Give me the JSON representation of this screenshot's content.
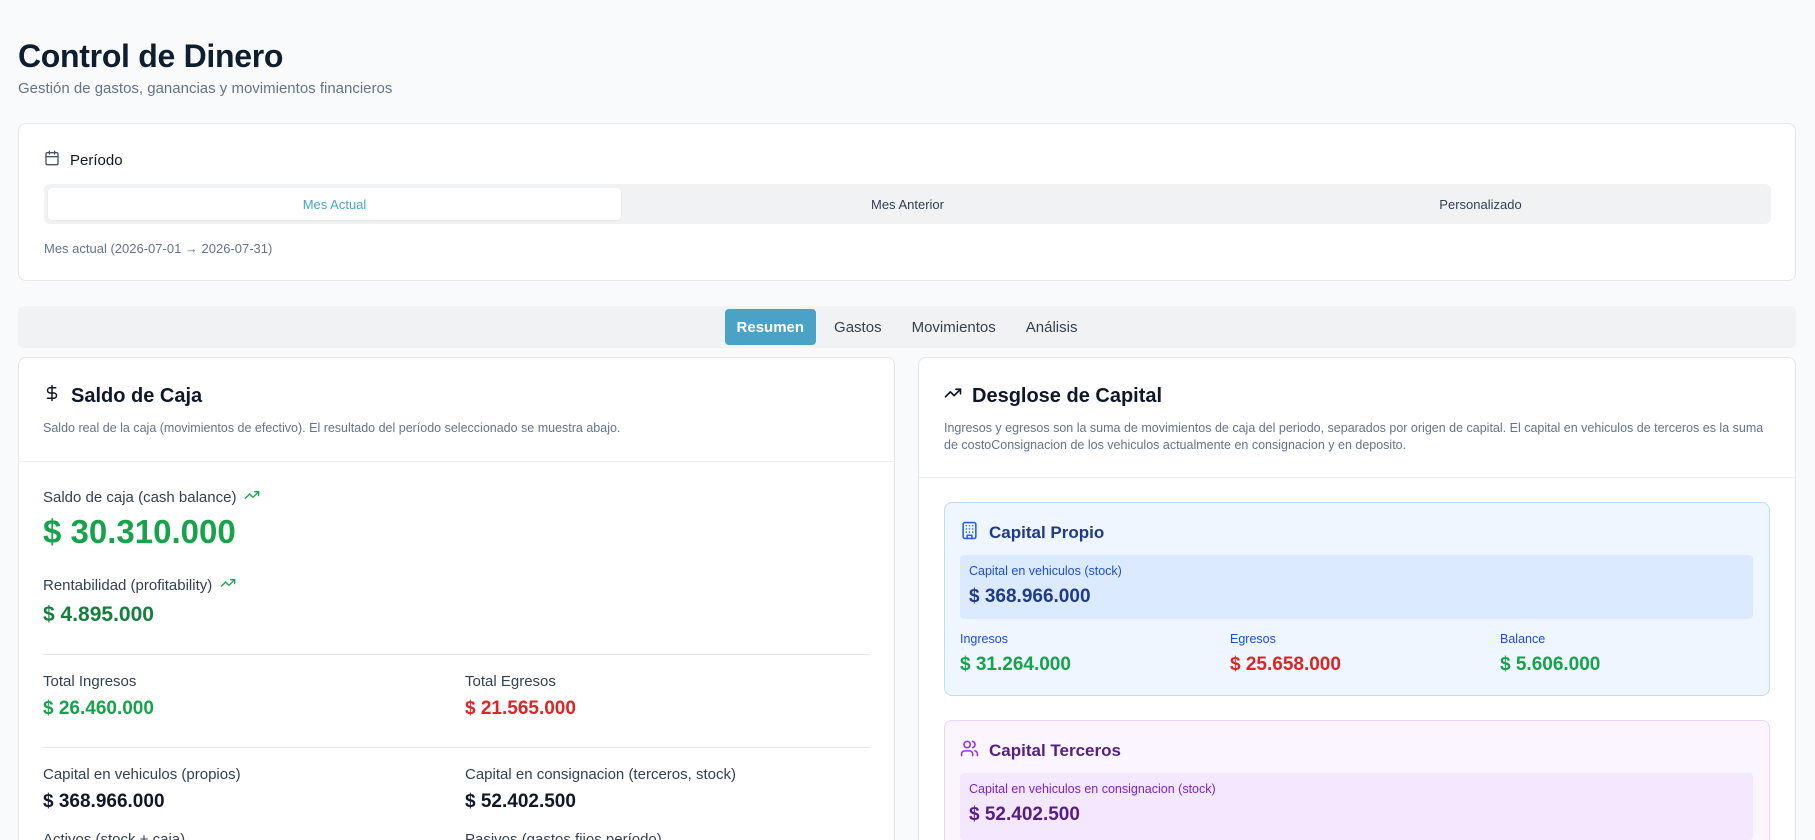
{
  "header": {
    "title": "Control de Dinero",
    "subtitle": "Gestión de gastos, ganancias y movimientos financieros"
  },
  "period": {
    "label": "Período",
    "tabs": [
      "Mes Actual",
      "Mes Anterior",
      "Personalizado"
    ],
    "active_tab": "Mes Actual",
    "range_text": "Mes actual (2026-07-01 → 2026-07-31)"
  },
  "main_tabs": {
    "items": [
      "Resumen",
      "Gastos",
      "Movimientos",
      "Análisis"
    ],
    "active": "Resumen"
  },
  "saldo": {
    "title": "Saldo de Caja",
    "description": "Saldo real de la caja (movimientos de efectivo). El resultado del período seleccionado se muestra abajo.",
    "cash_balance_label": "Saldo de caja (cash balance)",
    "cash_balance_value": "$ 30.310.000",
    "profitability_label": "Rentabilidad (profitability)",
    "profitability_value": "$ 4.895.000",
    "total_ingresos_label": "Total Ingresos",
    "total_ingresos_value": "$ 26.460.000",
    "total_egresos_label": "Total Egresos",
    "total_egresos_value": "$ 21.565.000",
    "capital_propios_label": "Capital en vehiculos (propios)",
    "capital_propios_value": "$ 368.966.000",
    "capital_consignacion_label": "Capital en consignacion (terceros, stock)",
    "capital_consignacion_value": "$ 52.402.500",
    "activos_label": "Activos (stock + caja)",
    "pasivos_label": "Pasivos (gastos fijos período)"
  },
  "capital": {
    "title": "Desglose de Capital",
    "description": "Ingresos y egresos son la suma de movimientos de caja del periodo, separados por origen de capital. El capital en vehiculos de terceros es la suma de costoConsignacion de los vehiculos actualmente en consignacion y en deposito.",
    "propio": {
      "title": "Capital Propio",
      "stock_label": "Capital en vehiculos (stock)",
      "stock_value": "$ 368.966.000",
      "ingresos_label": "Ingresos",
      "ingresos_value": "$ 31.264.000",
      "egresos_label": "Egresos",
      "egresos_value": "$ 25.658.000",
      "balance_label": "Balance",
      "balance_value": "$ 5.606.000"
    },
    "terceros": {
      "title": "Capital Terceros",
      "stock_label": "Capital en vehiculos en consignacion (stock)",
      "stock_value": "$ 52.402.500"
    }
  },
  "colors": {
    "accent": "#4aa3c7",
    "positive": "#16a34a",
    "negative": "#dc2626",
    "propio_bg": "#eff6ff",
    "propio_text": "#1e3a8a",
    "terceros_bg": "#faf5ff",
    "terceros_text": "#581c87"
  }
}
